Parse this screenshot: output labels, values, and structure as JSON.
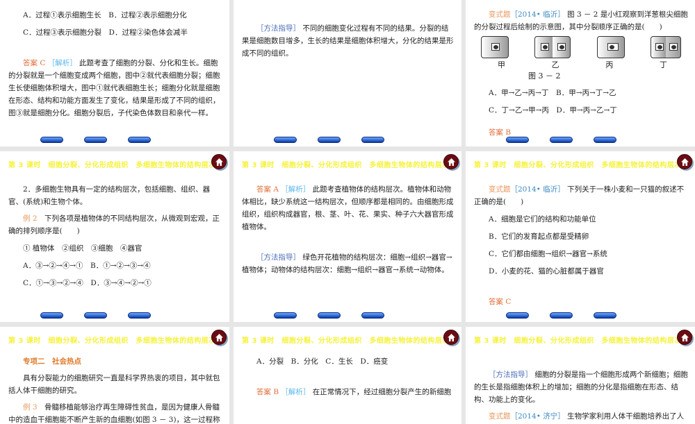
{
  "colors": {
    "header": "#f6f23a",
    "answer": "#e0703a",
    "analysis": "#5bb8ea",
    "method": "#4a6cb8",
    "variant": "#e8955a",
    "source": "#3a88c0",
    "example": "#e8955a",
    "topic": "#e07a2a"
  },
  "header_title": "第 3 课时　细胞分裂、分化形成组织　多细胞生物体的结构层次",
  "slides": [
    {
      "header": false,
      "blocks": [
        {
          "kind": "option",
          "segs": [
            [
              "A．过程①表示细胞生长　B．过程②表示细胞分化",
              ""
            ]
          ]
        },
        {
          "kind": "option",
          "segs": [
            [
              "C．过程③表示细胞分裂　D．过程②染色体会减半",
              ""
            ]
          ]
        },
        {
          "kind": "para gap",
          "segs": [
            [
              "答案 C ",
              "answer"
            ],
            [
              "［解析］",
              "analysis"
            ],
            [
              " 此题考查了细胞的分裂、分化和生长。细胞的分裂就是一个细胞变成两个细胞，图中②就代表细胞分裂；细胞生长使细胞体积增大，图中①就代表细胞生长；细胞分化就是细胞在形态、结构和功能方面发生了变化，结果是形成了不同的组织，图③就是细胞分化。细胞分裂后，子代染色体数目和亲代一样。",
              ""
            ]
          ]
        }
      ]
    },
    {
      "header": false,
      "blocks": [
        {
          "kind": "para gap",
          "segs": [
            [
              "［方法指导］",
              "method"
            ],
            [
              " 不同的细胞变化过程有不同的结果。分裂的结果是细胞数目增多，生长的结果是细胞体积增大，分化的结果是形成不同的组织。",
              ""
            ]
          ]
        }
      ]
    },
    {
      "header": false,
      "figure": {
        "labels": [
          "甲",
          "乙",
          "丙",
          "丁"
        ],
        "caption": "图 3 － 2"
      },
      "blocks": [
        {
          "kind": "para",
          "segs": [
            [
              "变式题",
              "variant"
            ],
            [
              "［2014• 临沂］",
              "source"
            ],
            [
              " 图 3 － 2 是小红观察到洋葱根尖细胞的分裂过程后绘制的示意图，其中分裂顺序正确的是(　　)",
              ""
            ]
          ]
        },
        {
          "kind": "figure"
        },
        {
          "kind": "option",
          "segs": [
            [
              "A．甲→乙→丙→丁　B．甲→丙→丁→乙",
              ""
            ]
          ]
        },
        {
          "kind": "option",
          "segs": [
            [
              "C．丁→乙→甲→丙　D．甲→丙→乙→丁",
              ""
            ]
          ]
        },
        {
          "kind": "answer",
          "segs": [
            [
              "答案 B",
              "answer"
            ]
          ]
        }
      ]
    },
    {
      "header": true,
      "blocks": [
        {
          "kind": "para",
          "segs": [
            [
              "2．多细胞生物具有一定的结构层次，包括细胞、组织、器官、(系统)和生物个体。",
              ""
            ]
          ]
        },
        {
          "kind": "para",
          "segs": [
            [
              "例 2",
              "example"
            ],
            [
              "　下列各项是植物体的不同结构层次，从微观到宏观，正确的排列顺序是(　　)",
              ""
            ]
          ]
        },
        {
          "kind": "option",
          "segs": [
            [
              "① 植物体　②组织　③细胞　④器官",
              ""
            ]
          ]
        },
        {
          "kind": "option",
          "segs": [
            [
              "A．③→②→④→①　B．①→②→③→④",
              ""
            ]
          ]
        },
        {
          "kind": "option",
          "segs": [
            [
              "C．①→③→②→④　D．③→④→②→①",
              ""
            ]
          ]
        }
      ]
    },
    {
      "header": true,
      "blocks": [
        {
          "kind": "para",
          "segs": [
            [
              "答案 A ",
              "answer"
            ],
            [
              "［解析］",
              "analysis"
            ],
            [
              " 此题考查植物体的结构层次。植物体和动物体相比，缺少系统这一结构层次，但顺序都是相同的。由细胞形成组织，组织构成器官，根、茎、叶、花、果实、种子六大器官形成植物体。",
              ""
            ]
          ]
        },
        {
          "kind": "para gap",
          "segs": [
            [
              "［方法指导］",
              "method"
            ],
            [
              " 绿色开花植物的结构层次：细胞→组织→器官→植物体；动物体的结构层次：细胞→组织→器官→系统→动物体。",
              ""
            ]
          ]
        }
      ]
    },
    {
      "header": true,
      "blocks": [
        {
          "kind": "para",
          "segs": [
            [
              "变式题",
              "variant"
            ],
            [
              "［2014• 临沂］",
              "source"
            ],
            [
              " 下列关于一株小麦和一只猫的叙述不正确的是(　　)",
              ""
            ]
          ]
        },
        {
          "kind": "option",
          "segs": [
            [
              "A．细胞是它们的结构和功能单位",
              ""
            ]
          ]
        },
        {
          "kind": "option",
          "segs": [
            [
              "B．它们的发育起点都是受精卵",
              ""
            ]
          ]
        },
        {
          "kind": "option",
          "segs": [
            [
              "C．它们都由细胞→组织→器官→系统",
              ""
            ]
          ]
        },
        {
          "kind": "option",
          "segs": [
            [
              "D．小麦的花、猫的心脏都属于器官",
              ""
            ]
          ]
        },
        {
          "kind": "answer gap",
          "segs": [
            [
              "答案 C",
              "answer"
            ]
          ]
        }
      ]
    },
    {
      "header": true,
      "blocks": [
        {
          "kind": "option",
          "segs": [
            [
              "专项二　社会热点",
              "topic"
            ]
          ]
        },
        {
          "kind": "para",
          "segs": [
            [
              "具有分裂能力的细胞研究一直是科学界热衷的项目，其中就包括人体干细胞的研究。",
              ""
            ]
          ]
        },
        {
          "kind": "para",
          "segs": [
            [
              "例 3",
              "example"
            ],
            [
              "　骨髓移植能够治疗再生障碍性贫血，是因为健康人骨髓中的造血干细胞能不断产生新的血细胞(如图 3 － 3)，这一过程称为细胞的(　　)",
              ""
            ]
          ]
        }
      ]
    },
    {
      "header": true,
      "blocks": [
        {
          "kind": "option",
          "segs": [
            [
              "A．分裂　B．分化　C．生长　D．癌变",
              ""
            ]
          ]
        },
        {
          "kind": "para gap",
          "segs": [
            [
              "答案 B ",
              "answer"
            ],
            [
              "［解析］",
              "analysis"
            ],
            [
              " 在正常情况下，经过细胞分裂产生的新细胞",
              ""
            ]
          ]
        }
      ]
    },
    {
      "header": true,
      "blocks": [
        {
          "kind": "para gap",
          "segs": [
            [
              "［方法指导］",
              "method"
            ],
            [
              " 细胞的分裂是指一个细胞形成两个新细胞；细胞的生长是指细胞体积上的增加；细胞的分化是指细胞在形态、结构、功能上的变化。",
              ""
            ]
          ]
        },
        {
          "kind": "para",
          "segs": [
            [
              "变式题",
              "variant"
            ],
            [
              "［2014• 济宁］",
              "source"
            ],
            [
              " 生物学家利用人体干细胞培养出了人体组织",
              ""
            ]
          ]
        }
      ]
    }
  ]
}
